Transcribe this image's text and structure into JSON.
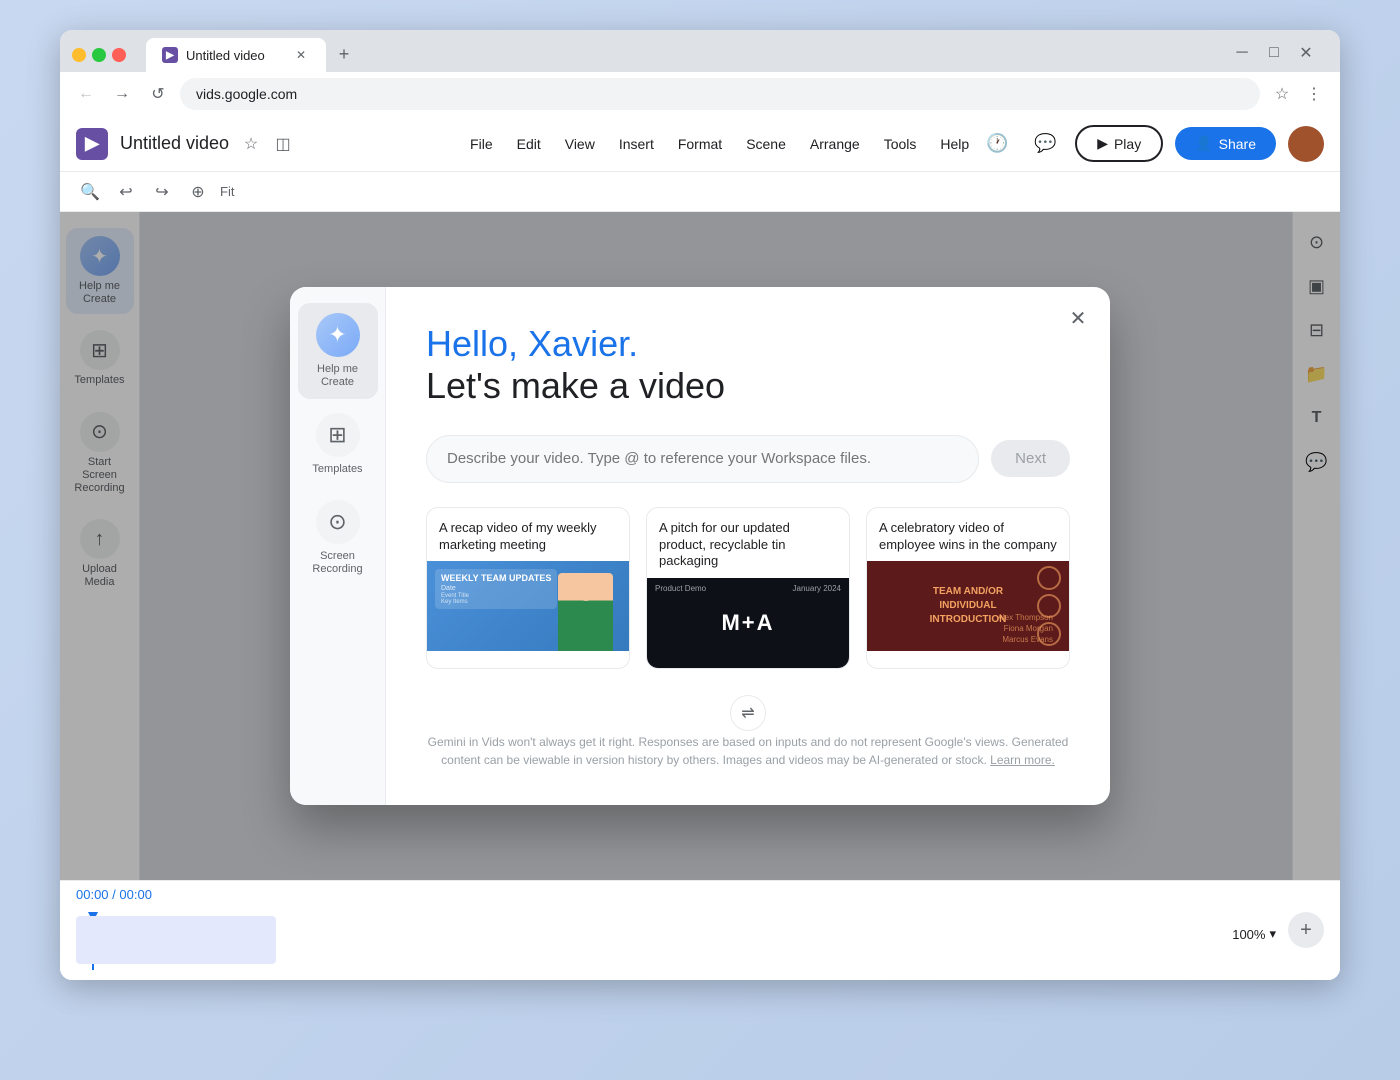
{
  "browser": {
    "tab_title": "Untitled video",
    "url": "vids.google.com",
    "favicon_letter": "▶",
    "new_tab_label": "+",
    "back_label": "←",
    "forward_label": "→",
    "reload_label": "↺",
    "bookmark_label": "☆",
    "menu_label": "⋮"
  },
  "app_header": {
    "logo_letter": "▶",
    "title": "Untitled video",
    "star_icon": "☆",
    "drive_icon": "□",
    "menu_items": [
      "File",
      "Edit",
      "View",
      "Insert",
      "Format",
      "Scene",
      "Arrange",
      "Tools",
      "Help"
    ],
    "history_icon": "🕐",
    "comments_icon": "💬",
    "play_label": "Play",
    "share_label": "Share"
  },
  "toolbar": {
    "search_icon": "🔍",
    "undo_icon": "↩",
    "redo_icon": "↪",
    "zoom_icon": "⊕",
    "fit_label": "Fit"
  },
  "left_sidebar": {
    "items": [
      {
        "id": "help-me-create",
        "label": "Help me Create",
        "icon": "✦"
      },
      {
        "id": "templates",
        "label": "Templates",
        "icon": "⊞"
      },
      {
        "id": "screen-recording",
        "label": "Start Screen Recording",
        "icon": "⊙"
      },
      {
        "id": "upload-media",
        "label": "Upload Media",
        "icon": "↑"
      }
    ]
  },
  "right_sidebar": {
    "buttons": [
      {
        "id": "record",
        "icon": "⊙"
      },
      {
        "id": "present",
        "icon": "▣"
      },
      {
        "id": "layout",
        "icon": "⊟"
      },
      {
        "id": "folder",
        "icon": "📁"
      },
      {
        "id": "text",
        "icon": "T"
      },
      {
        "id": "chat",
        "icon": "💬"
      }
    ]
  },
  "timeline": {
    "current_time": "00:00",
    "total_time": "00:00",
    "zoom_level": "100%",
    "add_icon": "+"
  },
  "modal": {
    "close_icon": "✕",
    "greeting_hello": "Hello, Xavier.",
    "subtitle": "Let's make a video",
    "input_placeholder": "Describe your video. Type @ to reference your Workspace files.",
    "next_button_label": "Next",
    "suggestions": [
      {
        "id": "weekly-meeting",
        "title": "A recap video of my weekly marketing meeting",
        "card_type": "weekly",
        "card_title": "WEEKLY TEAM UPDATES",
        "card_subtitle": "Date"
      },
      {
        "id": "product-pitch",
        "title": "A pitch for our updated product, recyclable tin packaging",
        "card_type": "product",
        "card_main_text": "M+A",
        "card_label": "Product Demo",
        "card_date": "January 2024"
      },
      {
        "id": "employee-wins",
        "title": "A celebratory video of employee wins in the company",
        "card_type": "employee",
        "card_main_text": "TEAM AND/OR INDIVIDUAL INTRODUCTION"
      }
    ],
    "shuffle_icon": "⇌",
    "footer_text": "Gemini in Vids won't always get it right. Responses are based on inputs and do not represent Google's views. Generated content can be viewable in version history by others. Images and videos may be AI-generated or stock.",
    "footer_link": "Learn more.",
    "ai_icon": "✦"
  },
  "sidebar_items": {
    "help_me_create_label": "Help me Create",
    "templates_label": "Templates",
    "screen_recording_label": "Start Screen Recording",
    "upload_media_label": "Upload Media"
  }
}
